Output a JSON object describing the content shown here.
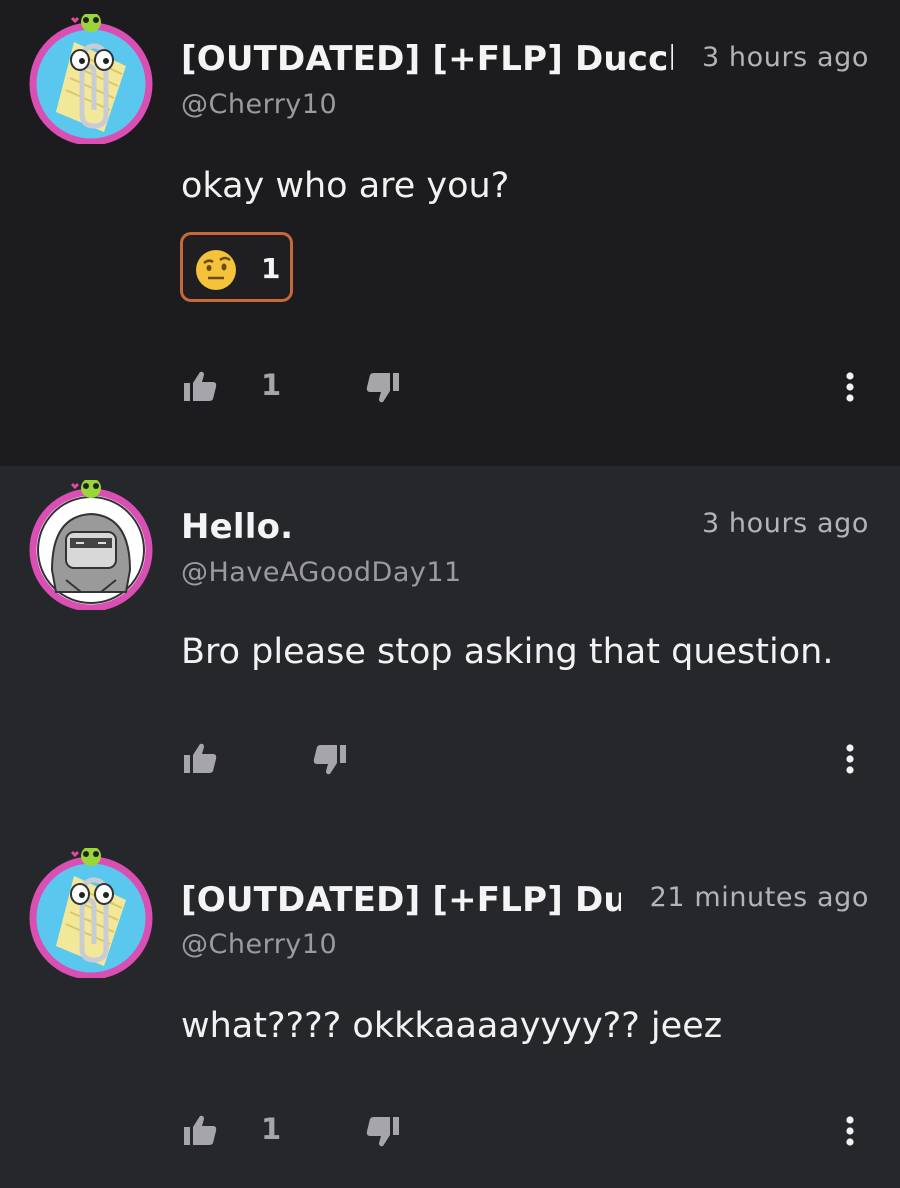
{
  "comments": [
    {
      "author": "[OUTDATED] [+FLP] Ducclyn",
      "handle": "@Cherry10",
      "time": "3 hours ago",
      "text": "okay who are you?",
      "reaction": {
        "emoji": "face-with-raised-eyebrow-icon",
        "count": "1"
      },
      "likes": "1",
      "avatar": "paperclip-avatar"
    },
    {
      "author": "Hello.",
      "handle": "@HaveAGoodDay11",
      "time": "3 hours ago",
      "text": "Bro please stop asking that question.",
      "likes": "",
      "avatar": "hooded-character-avatar"
    },
    {
      "author": "[OUTDATED] [+FLP] Ducclyn",
      "handle": "@Cherry10",
      "time": "21 minutes ago",
      "text": "what???? okkkaaaayyyy?? jeez",
      "likes": "1",
      "avatar": "paperclip-avatar"
    }
  ],
  "colors": {
    "background_first": "#1c1c1e",
    "background": "#26272b",
    "reaction_border": "#c8683a",
    "avatar_ring": "#d94fb3",
    "muted_text": "#9a9aa0"
  }
}
